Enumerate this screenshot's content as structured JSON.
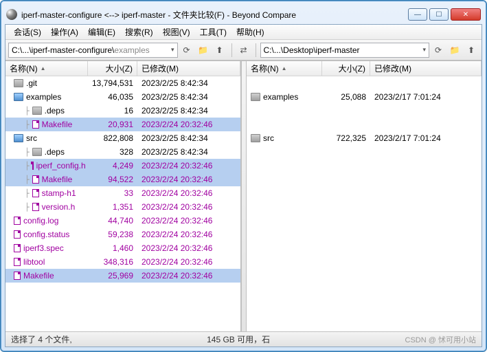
{
  "title": "iperf-master-configure <--> iperf-master - 文件夹比较(F) - Beyond Compare",
  "menu": [
    "会话(S)",
    "操作(A)",
    "编辑(E)",
    "搜索(R)",
    "视图(V)",
    "工具(T)",
    "帮助(H)"
  ],
  "paths": {
    "left": {
      "main": "C:\\...\\iperf-master-configure\\",
      "sub": "examples"
    },
    "right": {
      "main": "C:\\...\\Desktop\\iperf-master",
      "sub": ""
    }
  },
  "columns": {
    "name": "名称(N)",
    "size": "大小(Z)",
    "modified": "已修改(M)"
  },
  "left": [
    {
      "name": ".git",
      "size": "13,794,531",
      "mod": "2023/2/25 8:42:34",
      "kind": "folder-closed",
      "indent": 0,
      "diff": false,
      "sel": false
    },
    {
      "name": "examples",
      "size": "46,035",
      "mod": "2023/2/25 8:42:34",
      "kind": "folder-open",
      "indent": 0,
      "diff": false,
      "sel": false
    },
    {
      "name": ".deps",
      "size": "16",
      "mod": "2023/2/25 8:42:34",
      "kind": "folder-closed",
      "indent": 1,
      "diff": false,
      "sel": false
    },
    {
      "name": "Makefile",
      "size": "20,931",
      "mod": "2023/2/24 20:32:46",
      "kind": "file",
      "indent": 1,
      "diff": true,
      "sel": true
    },
    {
      "name": "src",
      "size": "822,808",
      "mod": "2023/2/25 8:42:34",
      "kind": "folder-open",
      "indent": 0,
      "diff": false,
      "sel": false
    },
    {
      "name": ".deps",
      "size": "328",
      "mod": "2023/2/25 8:42:34",
      "kind": "folder-closed",
      "indent": 1,
      "diff": false,
      "sel": false
    },
    {
      "name": "iperf_config.h",
      "size": "4,249",
      "mod": "2023/2/24 20:32:46",
      "kind": "file",
      "indent": 1,
      "diff": true,
      "sel": true
    },
    {
      "name": "Makefile",
      "size": "94,522",
      "mod": "2023/2/24 20:32:46",
      "kind": "file",
      "indent": 1,
      "diff": true,
      "sel": true
    },
    {
      "name": "stamp-h1",
      "size": "33",
      "mod": "2023/2/24 20:32:46",
      "kind": "file",
      "indent": 1,
      "diff": true,
      "sel": false
    },
    {
      "name": "version.h",
      "size": "1,351",
      "mod": "2023/2/24 20:32:46",
      "kind": "file",
      "indent": 1,
      "diff": true,
      "sel": false
    },
    {
      "name": "config.log",
      "size": "44,740",
      "mod": "2023/2/24 20:32:46",
      "kind": "file",
      "indent": 0,
      "diff": true,
      "sel": false
    },
    {
      "name": "config.status",
      "size": "59,238",
      "mod": "2023/2/24 20:32:46",
      "kind": "file",
      "indent": 0,
      "diff": true,
      "sel": false
    },
    {
      "name": "iperf3.spec",
      "size": "1,460",
      "mod": "2023/2/24 20:32:46",
      "kind": "file",
      "indent": 0,
      "diff": true,
      "sel": false
    },
    {
      "name": "libtool",
      "size": "348,316",
      "mod": "2023/2/24 20:32:46",
      "kind": "file",
      "indent": 0,
      "diff": true,
      "sel": false
    },
    {
      "name": "Makefile",
      "size": "25,969",
      "mod": "2023/2/24 20:32:46",
      "kind": "file",
      "indent": 0,
      "diff": true,
      "sel": true
    }
  ],
  "right": [
    {
      "name": "examples",
      "size": "25,088",
      "mod": "2023/2/17 7:01:24",
      "kind": "folder-closed",
      "indent": 0,
      "diff": false,
      "sel": false,
      "spacer": 0
    },
    {
      "name": "src",
      "size": "722,325",
      "mod": "2023/2/17 7:01:24",
      "kind": "folder-closed",
      "indent": 0,
      "diff": false,
      "sel": false,
      "spacer": 2
    }
  ],
  "status": {
    "left": "选择了 4 个文件,",
    "mid": "145 GB 可用，石",
    "right": "CSDN @ 怵可用小站"
  },
  "icons": {
    "refresh": "⟳",
    "folder": "📁",
    "up": "⬆",
    "swap": "⇄",
    "dropdown": "▾",
    "min": "—",
    "max": "☐",
    "close": "✕"
  }
}
